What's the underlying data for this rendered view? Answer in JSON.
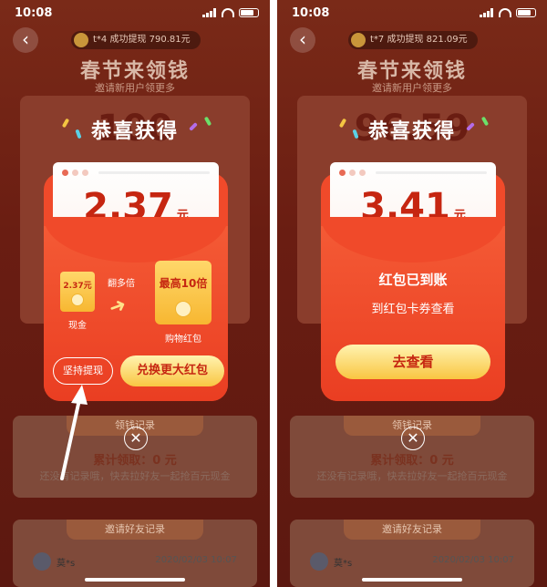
{
  "status_time": "10:08",
  "left": {
    "ticker": "t*4 成功提现 790.81元",
    "bg_title": "春节来领钱",
    "bg_subtitle": "邀请新用户领更多",
    "bg_amount": "100",
    "records_header": "领钱记录",
    "cumulative": "累计领取：0 元",
    "no_records": "还没有记录哦，快去拉好友一起抢百元现金",
    "invite_header": "邀请好友记录",
    "friend_name": "莫*s",
    "friend_date": "2020/02/03 10:07",
    "congrats": "恭喜获得",
    "amount": "2.37",
    "unit": "元",
    "cash_coupon": "2.37元",
    "cash_label": "现金",
    "multiply_label": "翻多倍",
    "shop_coupon": "最高10倍",
    "shop_label": "购物红包",
    "keep_withdraw": "坚持提现",
    "exchange": "兑换更大红包",
    "close": "✕"
  },
  "right": {
    "ticker": "t*7 成功提现 821.09元",
    "bg_title": "春节来领钱",
    "bg_subtitle": "邀请新用户领更多",
    "bg_amount": "96.59",
    "records_header": "领钱记录",
    "cumulative": "累计领取：0 元",
    "no_records": "还没有记录哦，快去拉好友一起抢百元现金",
    "invite_header": "邀请好友记录",
    "friend_name": "莫*s",
    "friend_date": "2020/02/03 10:07",
    "congrats": "恭喜获得",
    "amount": "3.41",
    "unit": "元",
    "received": "红包已到账",
    "check_hint": "到红包卡券查看",
    "view": "去查看",
    "close": "✕"
  },
  "colors": {
    "red": "#c62611",
    "envelope": "#f04a2a",
    "gold": "#f9c642"
  }
}
